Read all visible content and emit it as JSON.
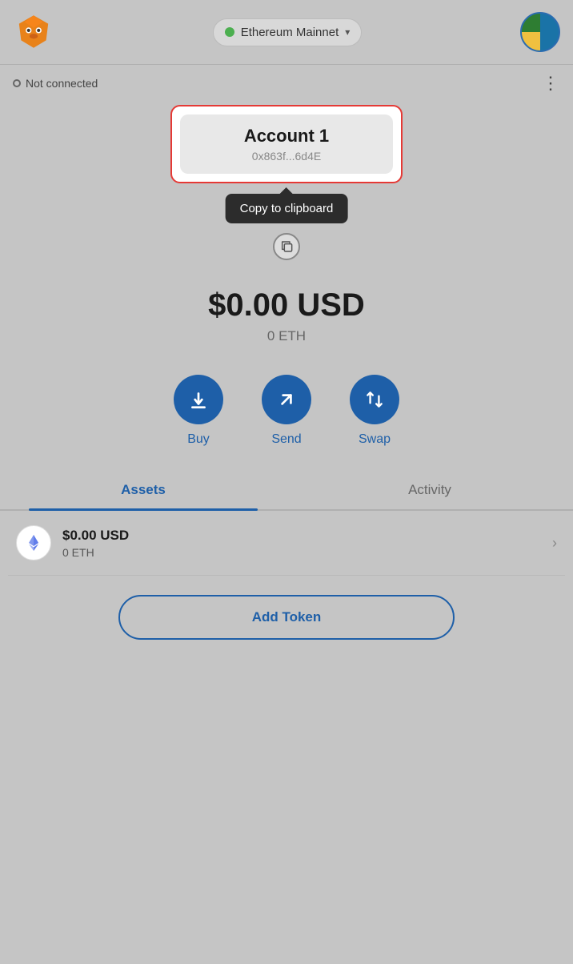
{
  "header": {
    "network_label": "Ethereum Mainnet",
    "logo_alt": "MetaMask fox logo"
  },
  "account_bar": {
    "not_connected_label": "Not connected",
    "more_options_label": "⋮"
  },
  "account_card": {
    "name": "Account 1",
    "address": "0x863f...6d4E"
  },
  "copy_tooltip": {
    "label": "Copy to clipboard"
  },
  "balance": {
    "usd": "$0.00 USD",
    "eth": "0 ETH"
  },
  "actions": {
    "buy_label": "Buy",
    "send_label": "Send",
    "swap_label": "Swap"
  },
  "tabs": {
    "assets_label": "Assets",
    "activity_label": "Activity"
  },
  "assets": {
    "eth_usd": "$0.00 USD",
    "eth_amount": "0 ETH"
  },
  "add_token_btn_label": "Add Token"
}
